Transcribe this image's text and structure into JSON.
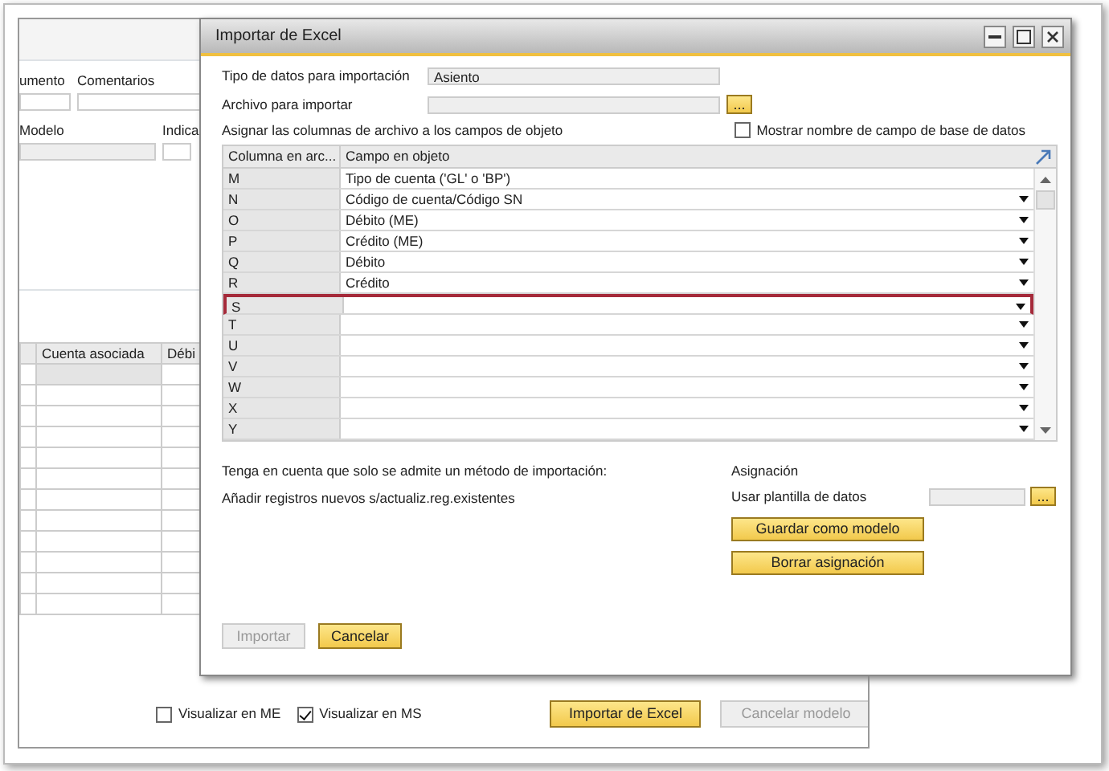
{
  "background_window": {
    "labels_row1": [
      "umento",
      "Comentarios"
    ],
    "labels_row2": [
      "Modelo",
      "Indica"
    ],
    "table": {
      "columns": [
        "Cuenta asociada",
        "Débi"
      ]
    },
    "checkboxes": [
      {
        "label": "Visualizar en ME",
        "checked": false
      },
      {
        "label": "Visualizar en MS",
        "checked": true
      }
    ],
    "buttons": [
      {
        "label": "Importar de Excel",
        "disabled": false
      },
      {
        "label": "Cancelar modelo",
        "disabled": true
      }
    ]
  },
  "dialog": {
    "title": "Importar de Excel",
    "data_type": {
      "label": "Tipo de datos para importación",
      "value": "Asiento"
    },
    "file": {
      "label": "Archivo para importar",
      "browse": "..."
    },
    "assign_label": "Asignar las columnas de archivo a los campos de objeto",
    "show_db_names": {
      "label": "Mostrar nombre de campo de base de datos",
      "checked": false
    },
    "grid": {
      "columns": [
        "Columna en arc...",
        "Campo en objeto"
      ],
      "rows": [
        {
          "column": "M",
          "field": "Tipo de cuenta ('GL' o 'BP')",
          "has_dropdown": false,
          "highlighted": false
        },
        {
          "column": "N",
          "field": "Código de cuenta/Código SN",
          "has_dropdown": true,
          "highlighted": false
        },
        {
          "column": "O",
          "field": "Débito (ME)",
          "has_dropdown": true,
          "highlighted": false
        },
        {
          "column": "P",
          "field": "Crédito (ME)",
          "has_dropdown": true,
          "highlighted": false
        },
        {
          "column": "Q",
          "field": "Débito",
          "has_dropdown": true,
          "highlighted": false
        },
        {
          "column": "R",
          "field": "Crédito",
          "has_dropdown": true,
          "highlighted": false
        },
        {
          "column": "S",
          "field": "",
          "has_dropdown": true,
          "highlighted": true
        },
        {
          "column": "T",
          "field": "",
          "has_dropdown": true,
          "highlighted": false
        },
        {
          "column": "U",
          "field": "",
          "has_dropdown": true,
          "highlighted": false
        },
        {
          "column": "V",
          "field": "",
          "has_dropdown": true,
          "highlighted": false
        },
        {
          "column": "W",
          "field": "",
          "has_dropdown": true,
          "highlighted": false
        },
        {
          "column": "X",
          "field": "",
          "has_dropdown": true,
          "highlighted": false
        },
        {
          "column": "Y",
          "field": "",
          "has_dropdown": true,
          "highlighted": false
        }
      ]
    },
    "note": "Tenga en cuenta que solo se admite un método de importación:",
    "method": "Añadir registros nuevos s/actualiz.reg.existentes",
    "assignment": {
      "title": "Asignación",
      "template_label": "Usar plantilla de datos",
      "browse": "...",
      "buttons": [
        "Guardar como modelo",
        "Borrar asignación"
      ]
    },
    "buttons": [
      {
        "label": "Importar",
        "disabled": true
      },
      {
        "label": "Cancelar",
        "disabled": false
      }
    ]
  }
}
